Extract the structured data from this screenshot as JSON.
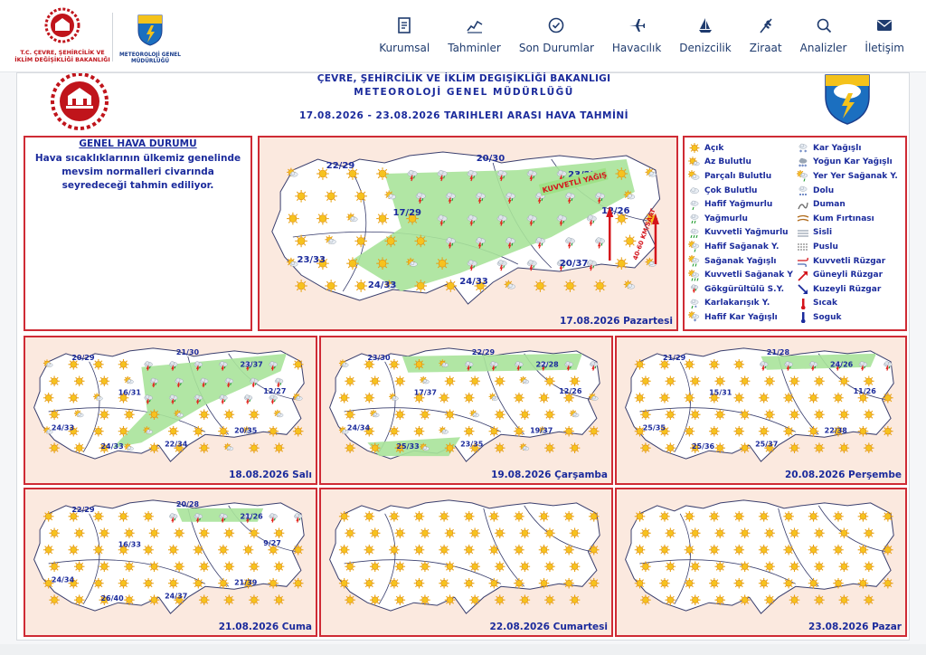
{
  "header": {
    "ministry_logo_text": "T.C. ÇEVRE, ŞEHİRCİLİK VE İKLİM DEĞİŞİKLİĞİ BAKANLIĞI",
    "mgm_logo_text": "METEOROLOJİ GENEL MÜDÜRLÜĞÜ",
    "nav": [
      {
        "label": "Kurumsal",
        "icon": "document-icon"
      },
      {
        "label": "Tahminler",
        "icon": "chart-icon"
      },
      {
        "label": "Son Durumlar",
        "icon": "check-circle-icon"
      },
      {
        "label": "Havacılık",
        "icon": "airplane-icon"
      },
      {
        "label": "Denizcilik",
        "icon": "sailboat-icon"
      },
      {
        "label": "Ziraat",
        "icon": "wheat-icon"
      },
      {
        "label": "Analizler",
        "icon": "magnifier-icon"
      },
      {
        "label": "İletişim",
        "icon": "envelope-icon"
      }
    ]
  },
  "forecast": {
    "title_line1": "ÇEVRE, ŞEHİRCİLİK VE İKLİM DEGIŞİKLİĞİ BAKANLIGI",
    "title_line2": "METEOROLOJİ GENEL MÜDÜRLÜĞÜ",
    "title_line3": "17.08.2026  -  23.08.2026   TARIHLERI ARASI HAVA TAHMİNİ",
    "general_title": "GENEL HAVA DURUMU",
    "general_text": "Hava sıcaklıklarının ülkemiz genelinde mevsim normalleri civarında seyredeceği tahmin ediliyor."
  },
  "maps": [
    {
      "date": "17.08.2026 Pazartesi",
      "temps": [
        "22/29",
        "20/30",
        "23/27",
        "17/29",
        "12/26",
        "23/33",
        "24/33",
        "24/33",
        "20/37"
      ],
      "annotations": [
        "KUVVETLİ YAĞIŞ",
        "40-60 KM/SAAT"
      ]
    },
    {
      "date": "18.08.2026 Salı",
      "temps": [
        "20/29",
        "21/30",
        "23/37",
        "16/31",
        "12/27",
        "24/33",
        "24/33",
        "22/34",
        "20/35"
      ]
    },
    {
      "date": "19.08.2026 Çarşamba",
      "temps": [
        "23/30",
        "22/29",
        "22/28",
        "17/37",
        "12/26",
        "24/34",
        "25/33",
        "23/35",
        "19/37"
      ]
    },
    {
      "date": "20.08.2026 Perşembe",
      "temps": [
        "21/29",
        "21/28",
        "24/26",
        "15/31",
        "11/26",
        "25/35",
        "25/36",
        "25/37",
        "22/38"
      ]
    },
    {
      "date": "21.08.2026 Cuma",
      "temps": [
        "22/29",
        "20/28",
        "21/26",
        "16/33",
        "9/27",
        "24/34",
        "26/40",
        "24/37",
        "21/39"
      ]
    },
    {
      "date": "22.08.2026 Cumartesi",
      "temps": []
    },
    {
      "date": "23.08.2026 Pazar",
      "temps": []
    }
  ],
  "legend": {
    "left": [
      {
        "label": "Açık",
        "icon": "sun-icon"
      },
      {
        "label": "Az Bulutlu",
        "icon": "sun-cloud-icon"
      },
      {
        "label": "Parçalı Bulutlu",
        "icon": "partly-cloudy-icon"
      },
      {
        "label": "Çok Bulutlu",
        "icon": "cloud-icon"
      },
      {
        "label": "Hafif Yağmurlu",
        "icon": "light-rain-icon"
      },
      {
        "label": "Yağmurlu",
        "icon": "rain-icon"
      },
      {
        "label": "Kuvvetli Yağmurlu",
        "icon": "heavy-rain-icon"
      },
      {
        "label": "Hafif Sağanak Y.",
        "icon": "light-shower-icon"
      },
      {
        "label": "Sağanak Yağışlı",
        "icon": "shower-icon"
      },
      {
        "label": "Kuvvetli Sağanak Y",
        "icon": "heavy-shower-icon"
      },
      {
        "label": "Gökgürültülü S.Y.",
        "icon": "thunder-icon"
      },
      {
        "label": "Karlakarışık Y.",
        "icon": "sleet-icon"
      },
      {
        "label": "Hafif Kar Yağışlı",
        "icon": "light-snow-icon"
      }
    ],
    "right": [
      {
        "label": "Kar Yağışlı",
        "icon": "snow-icon"
      },
      {
        "label": "Yoğun Kar Yağışlı",
        "icon": "heavy-snow-icon"
      },
      {
        "label": "Yer Yer Sağanak Y.",
        "icon": "scattered-shower-icon"
      },
      {
        "label": "Dolu",
        "icon": "hail-icon"
      },
      {
        "label": "Duman",
        "icon": "smoke-icon"
      },
      {
        "label": "Kum Fırtınası",
        "icon": "sandstorm-icon"
      },
      {
        "label": "Sisli",
        "icon": "fog-icon"
      },
      {
        "label": "Puslu",
        "icon": "haze-icon"
      },
      {
        "label": "Kuvvetli Rüzgar",
        "icon": "strong-wind-icon"
      },
      {
        "label": "Güneyli Rüzgar",
        "icon": "south-wind-arrow-icon"
      },
      {
        "label": "Kuzeyli Rüzgar",
        "icon": "north-wind-arrow-icon"
      },
      {
        "label": "Sıcak",
        "icon": "hot-thermometer-icon"
      },
      {
        "label": "Soguk",
        "icon": "cold-thermometer-icon"
      }
    ]
  },
  "colors": {
    "accent_red": "#cf2b35",
    "text_blue": "#1b2b9c",
    "nav_text": "#1f3b6e",
    "map_bg": "#fbe9df",
    "land": "#ffffff",
    "rain_area": "#a8e39a",
    "sun": "#f6b21b"
  }
}
